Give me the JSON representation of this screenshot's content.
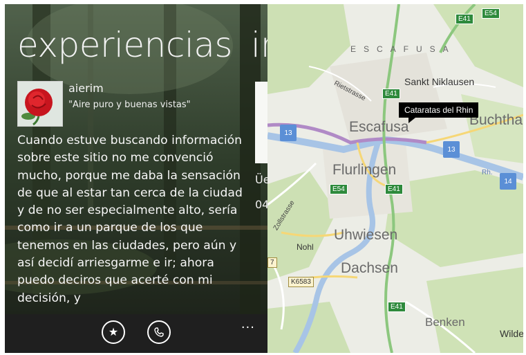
{
  "left": {
    "title": "experiencias",
    "title_next": "in",
    "author": "aierim",
    "quote": "\"Aire puro y buenas vistas\"",
    "body": "Cuando estuve buscando información sobre este sitio no me convenció mucho, porque me daba la sensación de que al estar tan cerca de la ciudad y de no ser especialmente alto, sería como ir a un parque de los que tenemos en las ciudades, pero aún y así decidí arriesgarme e ir; ahora puedo deciros que acerté con mi decisión, y",
    "peek_line1": "Üe",
    "peek_line2": "04",
    "appbar": {
      "more": "..."
    }
  },
  "map": {
    "tooltip": "Cataratas del Rhin",
    "labels": {
      "escafusa_spaced": "ESCAFUSA",
      "escafusa": "Escafusa",
      "flurlingen": "Flurlingen",
      "uhwiesen": "Uhwiesen",
      "dachsen": "Dachsen",
      "benken": "Benken",
      "wilde": "Wilde",
      "sankt": "Sankt Niklausen",
      "buchthale": "Buchthale",
      "nohl": "Nohl",
      "rietstrasse": "Rietstrasse",
      "zollstrasse": "Zollstrasse",
      "rh": "Rh."
    },
    "shields": {
      "e41a": "E41",
      "e54a": "E54",
      "e41b": "E41",
      "e54b": "E54",
      "e41c": "E41",
      "e41d": "E41",
      "b13a": "13",
      "b13b": "13",
      "b14": "14",
      "k6583": "K6583",
      "k7": "7"
    }
  }
}
